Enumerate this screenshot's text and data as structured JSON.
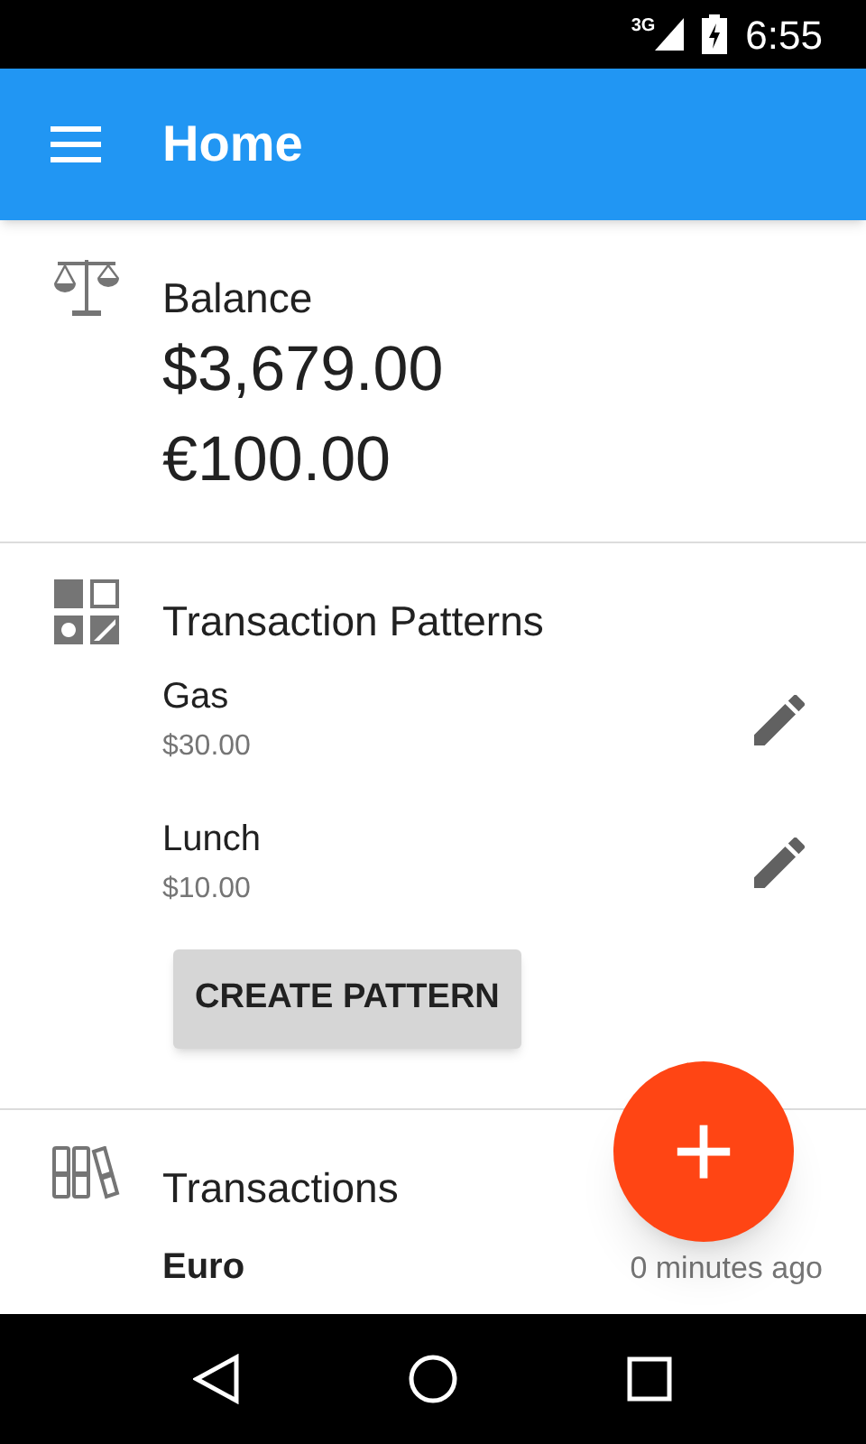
{
  "status_bar": {
    "network": "3G",
    "time": "6:55"
  },
  "app_bar": {
    "title": "Home"
  },
  "balance": {
    "title": "Balance",
    "amounts": [
      "$3,679.00",
      "€100.00"
    ]
  },
  "patterns": {
    "title": "Transaction Patterns",
    "items": [
      {
        "name": "Gas",
        "amount": "$30.00"
      },
      {
        "name": "Lunch",
        "amount": "$10.00"
      }
    ],
    "button": "CREATE PATTERN"
  },
  "transactions": {
    "title": "Transactions",
    "items": [
      {
        "account": "Euro",
        "time": "0 minutes ago"
      }
    ]
  },
  "fab": {
    "label": "+"
  }
}
